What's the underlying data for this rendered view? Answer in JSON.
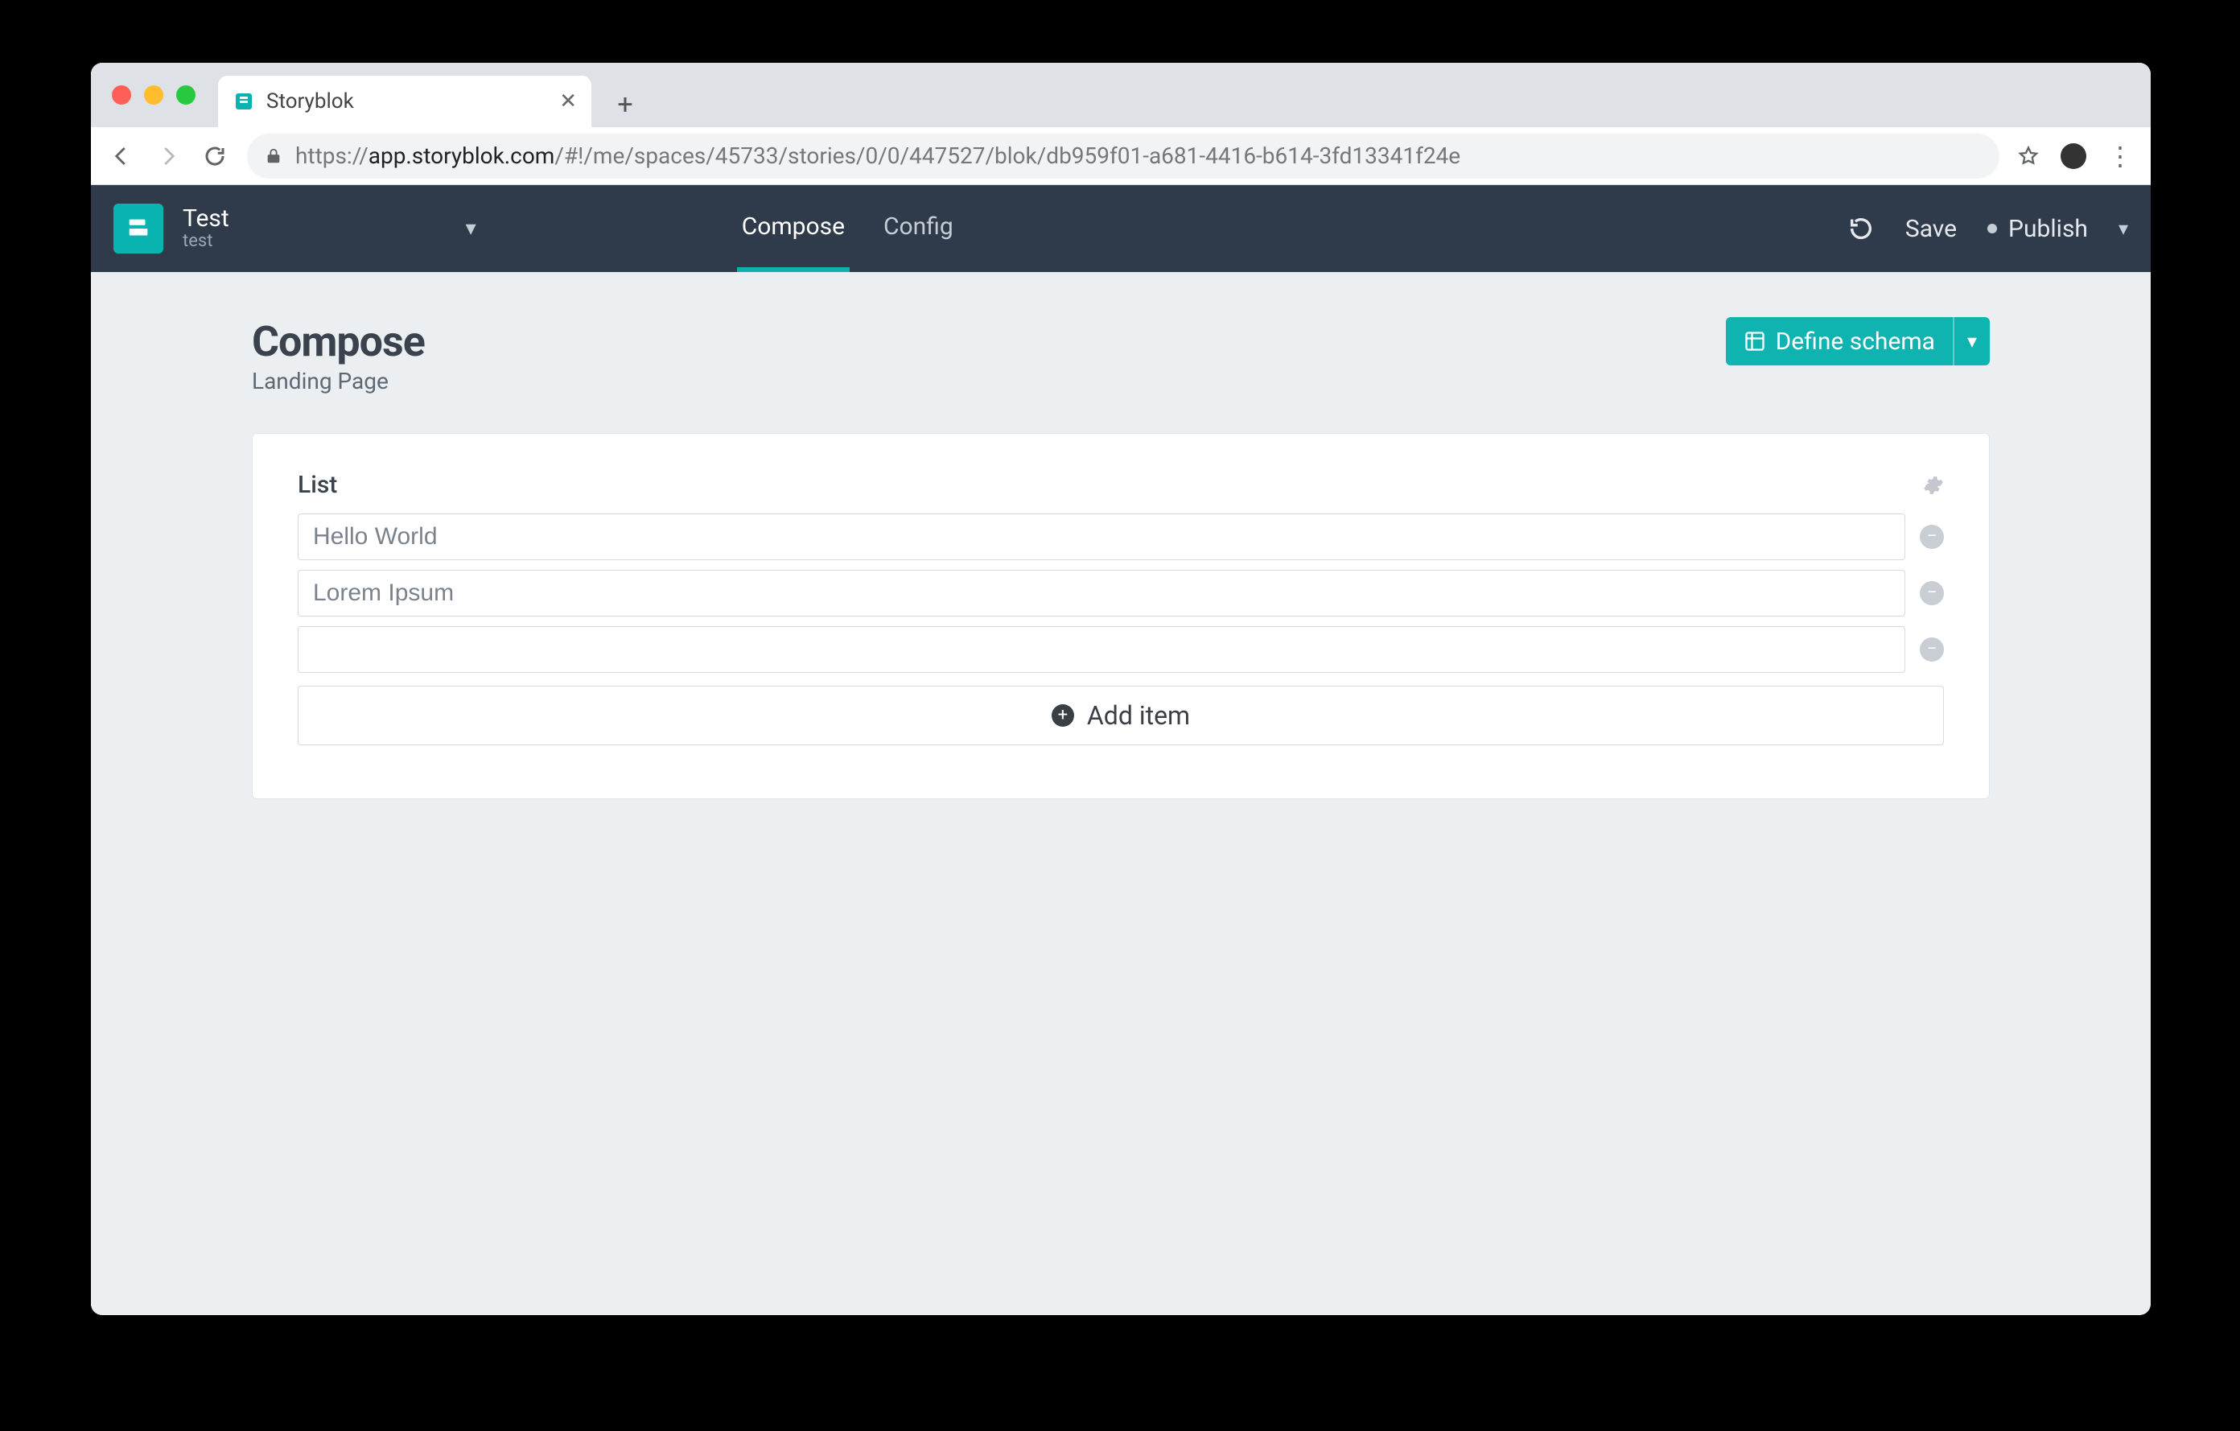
{
  "browser": {
    "tab_title": "Storyblok",
    "url_prefix": "https://",
    "url_host": "app.storyblok.com",
    "url_path": "/#!/me/spaces/45733/stories/0/0/447527/blok/db959f01-a681-4416-b614-3fd13341f24e"
  },
  "header": {
    "space_title": "Test",
    "space_slug": "test",
    "tabs": {
      "compose": "Compose",
      "config": "Config"
    },
    "actions": {
      "save": "Save",
      "publish": "Publish"
    }
  },
  "workspace": {
    "title": "Compose",
    "subtitle": "Landing Page",
    "define_schema": "Define schema"
  },
  "field": {
    "label": "List",
    "items": [
      "Hello World",
      "Lorem Ipsum",
      ""
    ],
    "add_label": "Add item"
  }
}
